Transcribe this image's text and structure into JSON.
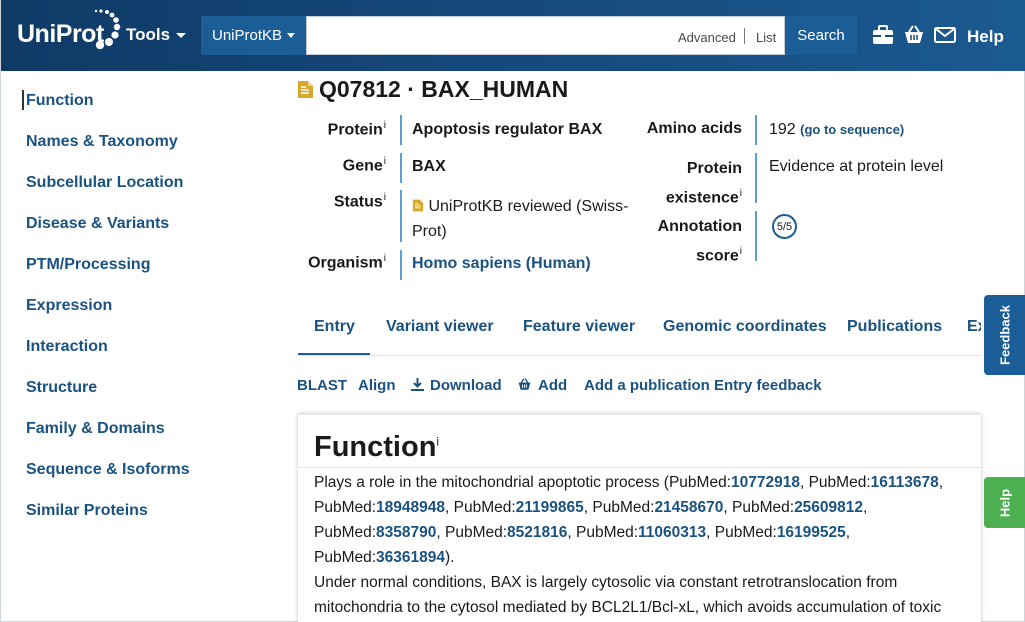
{
  "header": {
    "logo_text": "UniProt",
    "tools_label": "Tools",
    "db_select": "UniProtKB",
    "search_placeholder": "",
    "advanced_label": "Advanced",
    "list_label": "List",
    "search_button": "Search",
    "help_label": "Help"
  },
  "sidebar": {
    "items": [
      {
        "label": "Function"
      },
      {
        "label": "Names & Taxonomy"
      },
      {
        "label": "Subcellular Location"
      },
      {
        "label": "Disease & Variants"
      },
      {
        "label": "PTM/Processing"
      },
      {
        "label": "Expression"
      },
      {
        "label": "Interaction"
      },
      {
        "label": "Structure"
      },
      {
        "label": "Family & Domains"
      },
      {
        "label": "Sequence & Isoforms"
      },
      {
        "label": "Similar Proteins"
      }
    ]
  },
  "entry": {
    "title": "Q07812 · BAX_HUMAN",
    "protein_label": "Protein",
    "protein_value": "Apoptosis regulator BAX",
    "gene_label": "Gene",
    "gene_value": "BAX",
    "status_label": "Status",
    "status_line1": "UniProtKB reviewed (Swiss-",
    "status_line2": "Prot)",
    "organism_label": "Organism",
    "organism_value": "Homo sapiens (Human)",
    "amino_label": "Amino acids",
    "amino_value": "192",
    "amino_link": "(go to sequence)",
    "existence_label1": "Protein",
    "existence_label2": "existence",
    "existence_value": "Evidence at protein level",
    "annotation_label1": "Annotation",
    "annotation_label2": "score",
    "annotation_value": "5/5",
    "info_mark": "i"
  },
  "tabs": [
    "Entry",
    "Variant viewer",
    "Feature viewer",
    "Genomic coordinates",
    "Publications",
    "Ex"
  ],
  "toolbar": {
    "blast": "BLAST",
    "align": "Align",
    "download": "Download",
    "add": "Add",
    "add_publication": "Add a publication",
    "entry_feedback": "Entry feedback"
  },
  "function": {
    "title": "Function",
    "line1_text": "Plays a role in the mitochondrial apoptotic process (PubMed:",
    "pm1": "10772918",
    "sep1": ", PubMed:",
    "pm2": "16113678",
    "tail1": ",",
    "line2_pre": "PubMed:",
    "pm3": "18948948",
    "sep3": ", PubMed:",
    "pm4": "21199865",
    "sep4": ", PubMed:",
    "pm5": "21458670",
    "sep5": ", PubMed:",
    "pm6": "25609812",
    "tail2": ",",
    "line3_pre": "PubMed:",
    "pm7": "8358790",
    "sep7": ", PubMed:",
    "pm8": "8521816",
    "sep8": ", PubMed:",
    "pm9": "11060313",
    "sep9": ", PubMed:",
    "pm10": "16199525",
    "tail3": ",",
    "line4_pre": "PubMed:",
    "pm11": "36361894",
    "tail4": ").",
    "line5": "Under normal conditions, BAX is largely cytosolic via constant retrotranslocation from",
    "line6": "mitochondria to the cytosol mediated by BCL2L1/Bcl-xL, which avoids accumulation of toxic"
  },
  "side_tabs": {
    "feedback": "Feedback",
    "help": "Help"
  },
  "colors": {
    "header_bg": "#15487a",
    "link": "#1a5281",
    "accent_bar": "#5aa2d6",
    "help_tab": "#4caf50"
  }
}
